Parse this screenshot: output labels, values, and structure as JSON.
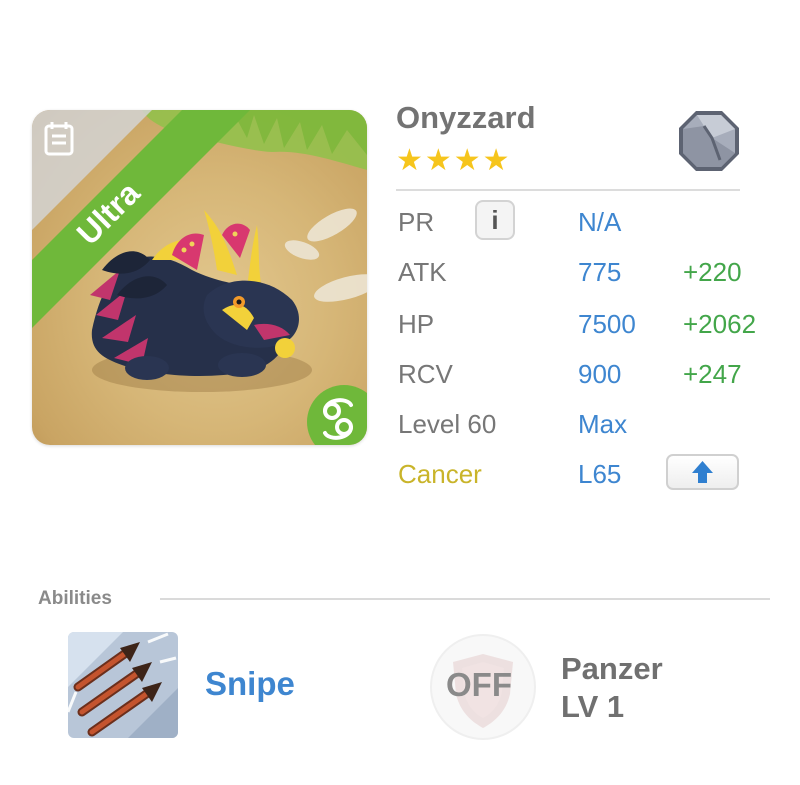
{
  "monster": {
    "name": "Onyzzard",
    "stars": "★★★★",
    "rarity_label": "Ultra",
    "evolution_icon": "octagon-stone-icon",
    "zodiac_icon": "cancer-icon"
  },
  "stats": [
    {
      "label": "PR",
      "value": "N/A",
      "bonus": ""
    },
    {
      "label": "ATK",
      "value": "775",
      "bonus": "+220"
    },
    {
      "label": "HP",
      "value": "7500",
      "bonus": "+2062"
    },
    {
      "label": "RCV",
      "value": "900",
      "bonus": "+247"
    },
    {
      "label": "Level 60",
      "value": "Max",
      "bonus": ""
    },
    {
      "label": "Cancer",
      "value": "L65",
      "bonus": ""
    }
  ],
  "info_button": {
    "glyph": "i"
  },
  "abilities": {
    "header": "Abilities",
    "items": [
      {
        "name": "Snipe",
        "icon": "arrows-icon"
      },
      {
        "name_line1": "Panzer",
        "name_line2": "LV 1",
        "state": "OFF",
        "icon": "shield-icon"
      }
    ]
  },
  "colors": {
    "rarity_banner": "#6fb83a",
    "value_blue": "#3e86d0",
    "bonus_green": "#43a64a",
    "zodiac_yellow": "#c9b42a",
    "star_gold": "#f6c51c"
  }
}
